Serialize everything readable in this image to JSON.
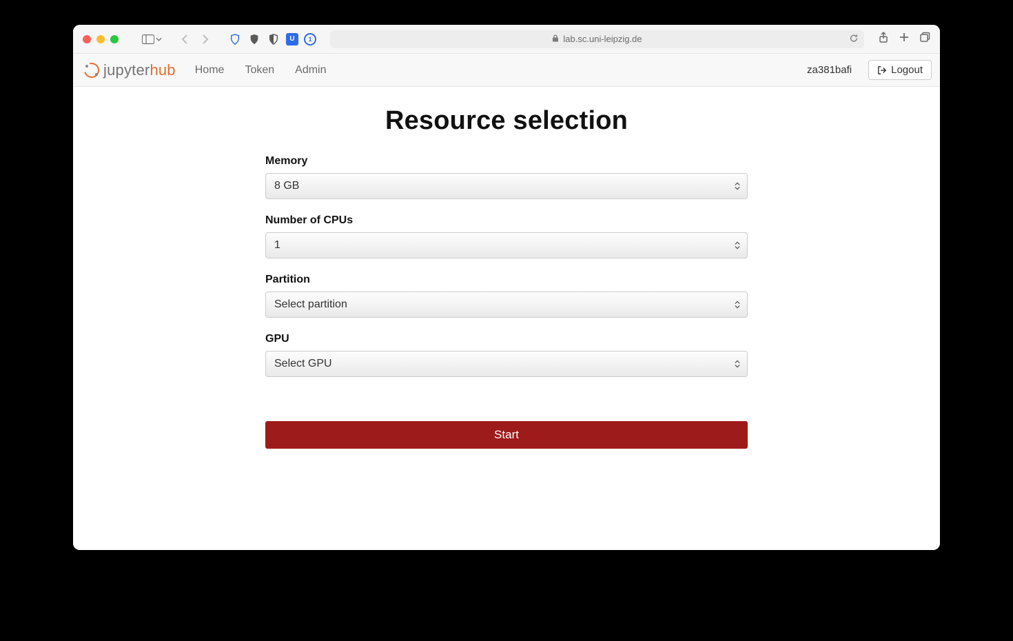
{
  "browser": {
    "url": "lab.sc.uni-leipzig.de"
  },
  "navbar": {
    "brand_prefix": "jupyter",
    "brand_suffix": "hub",
    "links": {
      "home": "Home",
      "token": "Token",
      "admin": "Admin"
    },
    "username": "za381bafi",
    "logout_label": "Logout"
  },
  "page": {
    "title": "Resource selection",
    "fields": {
      "memory": {
        "label": "Memory",
        "value": "8 GB"
      },
      "cpus": {
        "label": "Number of CPUs",
        "value": "1"
      },
      "partition": {
        "label": "Partition",
        "value": "Select partition"
      },
      "gpu": {
        "label": "GPU",
        "value": "Select GPU"
      }
    },
    "start_label": "Start"
  }
}
